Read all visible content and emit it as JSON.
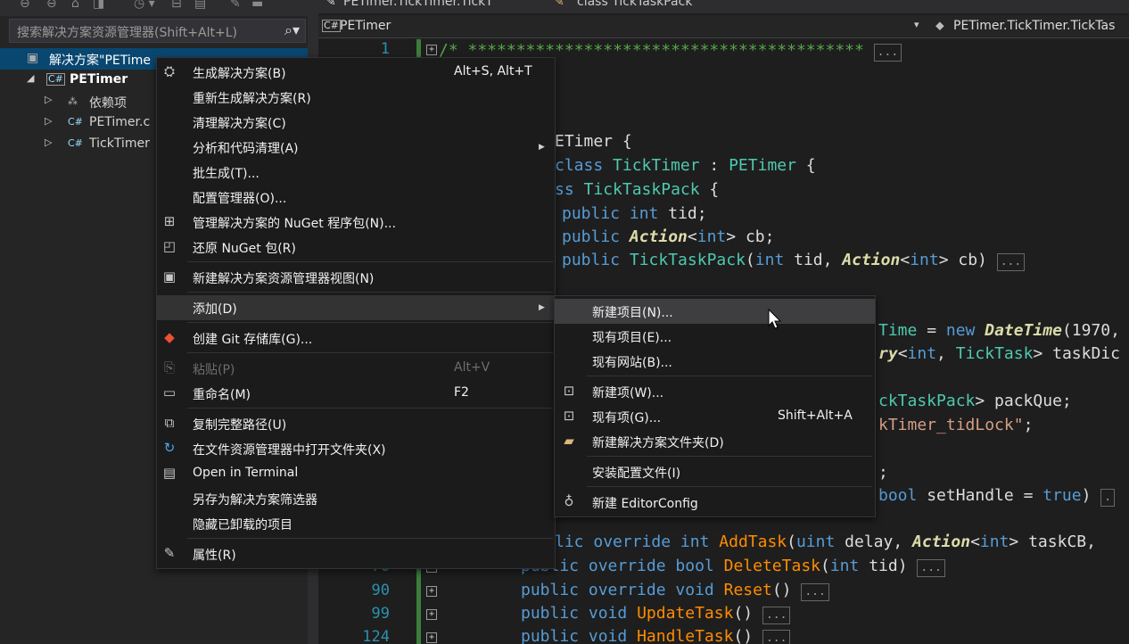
{
  "se": {
    "search_placeholder": "搜索解决方案资源管理器(Shift+Alt+L)",
    "solution_label": "解决方案\"PETime",
    "project_label": "PETimer",
    "items": [
      {
        "icon": "dependencies-icon",
        "label": "依赖项"
      },
      {
        "icon": "csharp-file-icon",
        "label": "PETimer.c"
      },
      {
        "icon": "csharp-file-icon",
        "label": "TickTimer"
      }
    ]
  },
  "editor": {
    "top_left": "PETimer.TickTimer.TickT",
    "top_right": "class TickTaskPack",
    "file_dropdown": "PETimer",
    "member_dropdown": "PETimer.TickTimer.TickTas",
    "line_numbers": [
      "1",
      "76",
      "90",
      "99",
      "124"
    ]
  },
  "context_menu": {
    "items": [
      {
        "label": "生成解决方案(B)",
        "shortcut": "Alt+S, Alt+T",
        "icon": "build-icon"
      },
      {
        "label": "重新生成解决方案(R)",
        "shortcut": "",
        "icon": ""
      },
      {
        "label": "清理解决方案(C)",
        "shortcut": "",
        "icon": ""
      },
      {
        "label": "分析和代码清理(A)",
        "shortcut": "",
        "icon": ""
      },
      {
        "label": "批生成(T)...",
        "shortcut": "",
        "icon": ""
      },
      {
        "label": "配置管理器(O)...",
        "shortcut": "",
        "icon": ""
      },
      {
        "label": "管理解决方案的 NuGet 程序包(N)...",
        "shortcut": "",
        "icon": "nuget-icon"
      },
      {
        "label": "还原 NuGet 包(R)",
        "shortcut": "",
        "icon": "restore-icon"
      },
      {
        "label": "新建解决方案资源管理器视图(N)",
        "shortcut": "",
        "icon": "new-view-icon"
      },
      {
        "label": "添加(D)",
        "shortcut": "",
        "icon": ""
      },
      {
        "label": "创建 Git 存储库(G)...",
        "shortcut": "",
        "icon": "git-icon"
      },
      {
        "label": "粘贴(P)",
        "shortcut": "Alt+V",
        "icon": "paste-icon"
      },
      {
        "label": "重命名(M)",
        "shortcut": "F2",
        "icon": "rename-icon"
      },
      {
        "label": "复制完整路径(U)",
        "shortcut": "",
        "icon": "copy-icon"
      },
      {
        "label": "在文件资源管理器中打开文件夹(X)",
        "shortcut": "",
        "icon": "open-folder-icon"
      },
      {
        "label": "Open in Terminal",
        "shortcut": "",
        "icon": "terminal-icon"
      },
      {
        "label": "另存为解决方案筛选器",
        "shortcut": "",
        "icon": ""
      },
      {
        "label": "隐藏已卸载的项目",
        "shortcut": "",
        "icon": ""
      },
      {
        "label": "属性(R)",
        "shortcut": "",
        "icon": "wrench-icon"
      }
    ]
  },
  "submenu": {
    "items": [
      {
        "label": "新建项目(N)...",
        "shortcut": "",
        "icon": ""
      },
      {
        "label": "现有项目(E)...",
        "shortcut": "",
        "icon": ""
      },
      {
        "label": "现有网站(B)...",
        "shortcut": "",
        "icon": ""
      },
      {
        "label": "新建项(W)...",
        "shortcut": "",
        "icon": "new-item-icon"
      },
      {
        "label": "现有项(G)...",
        "shortcut": "Shift+Alt+A",
        "icon": "existing-item-icon"
      },
      {
        "label": "新建解决方案文件夹(D)",
        "shortcut": "",
        "icon": "solution-folder-icon"
      },
      {
        "label": "安装配置文件(I)",
        "shortcut": "",
        "icon": ""
      },
      {
        "label": "新建 EditorConfig",
        "shortcut": "",
        "icon": "editorconfig-icon"
      }
    ]
  }
}
